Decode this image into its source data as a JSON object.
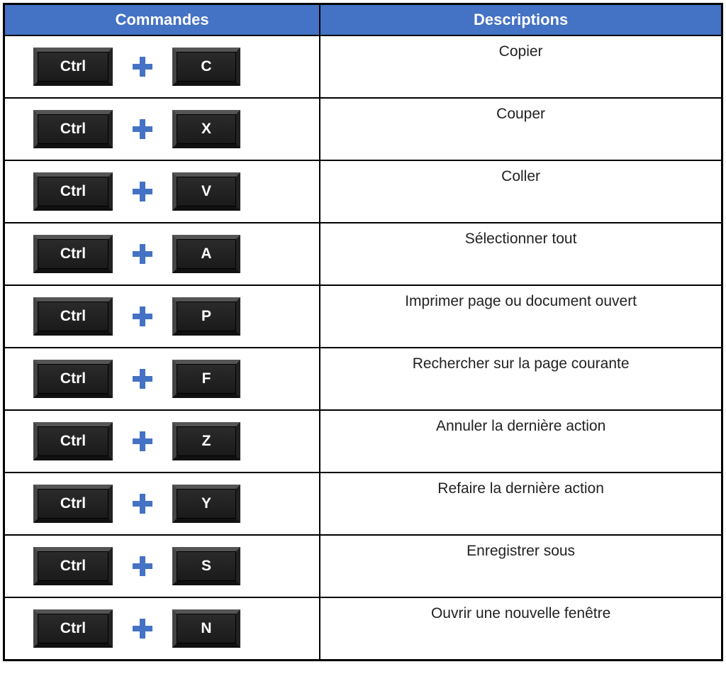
{
  "header": {
    "commands": "Commandes",
    "descriptions": "Descriptions"
  },
  "modifier": "Ctrl",
  "rows": [
    {
      "key": "C",
      "desc": "Copier"
    },
    {
      "key": "X",
      "desc": "Couper"
    },
    {
      "key": "V",
      "desc": "Coller"
    },
    {
      "key": "A",
      "desc": "Sélectionner tout"
    },
    {
      "key": "P",
      "desc": "Imprimer page ou document ouvert"
    },
    {
      "key": "F",
      "desc": "Rechercher sur la page courante"
    },
    {
      "key": "Z",
      "desc": "Annuler la dernière action"
    },
    {
      "key": "Y",
      "desc": "Refaire la dernière action"
    },
    {
      "key": "S",
      "desc": "Enregistrer sous"
    },
    {
      "key": "N",
      "desc": "Ouvrir une nouvelle fenêtre"
    }
  ],
  "colors": {
    "accent": "#4472c4"
  }
}
